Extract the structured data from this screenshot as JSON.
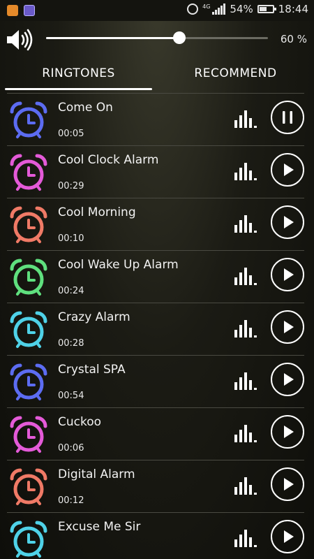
{
  "status_bar": {
    "network": "4G",
    "battery_percent": "54%",
    "battery_level": 0.54,
    "time": "18:44",
    "icons": [
      "notification-orange-icon",
      "notification-purple-icon",
      "alarm-icon",
      "signal-icon",
      "battery-icon"
    ]
  },
  "volume": {
    "icon": "speaker-icon",
    "level": 0.6,
    "label": "60 %"
  },
  "tabs": [
    {
      "label": "RINGTONES",
      "active": true
    },
    {
      "label": "RECOMMEND",
      "active": false
    }
  ],
  "ringtones": [
    {
      "title": "Come On",
      "duration": "00:05",
      "color": "#5c6cf2",
      "state": "playing"
    },
    {
      "title": "Cool Clock Alarm",
      "duration": "00:29",
      "color": "#e45ad8",
      "state": "stopped"
    },
    {
      "title": "Cool Morning",
      "duration": "00:10",
      "color": "#f07a66",
      "state": "stopped"
    },
    {
      "title": "Cool Wake Up Alarm",
      "duration": "00:24",
      "color": "#5fe07e",
      "state": "stopped"
    },
    {
      "title": "Crazy Alarm",
      "duration": "00:28",
      "color": "#4fd2e8",
      "state": "stopped"
    },
    {
      "title": "Crystal SPA",
      "duration": "00:54",
      "color": "#5c6cf2",
      "state": "stopped"
    },
    {
      "title": "Cuckoo",
      "duration": "00:06",
      "color": "#e45ad8",
      "state": "stopped"
    },
    {
      "title": "Digital Alarm",
      "duration": "00:12",
      "color": "#f07a66",
      "state": "stopped"
    },
    {
      "title": "Excuse Me Sir",
      "duration": "",
      "color": "#4fd2e8",
      "state": "stopped"
    }
  ]
}
